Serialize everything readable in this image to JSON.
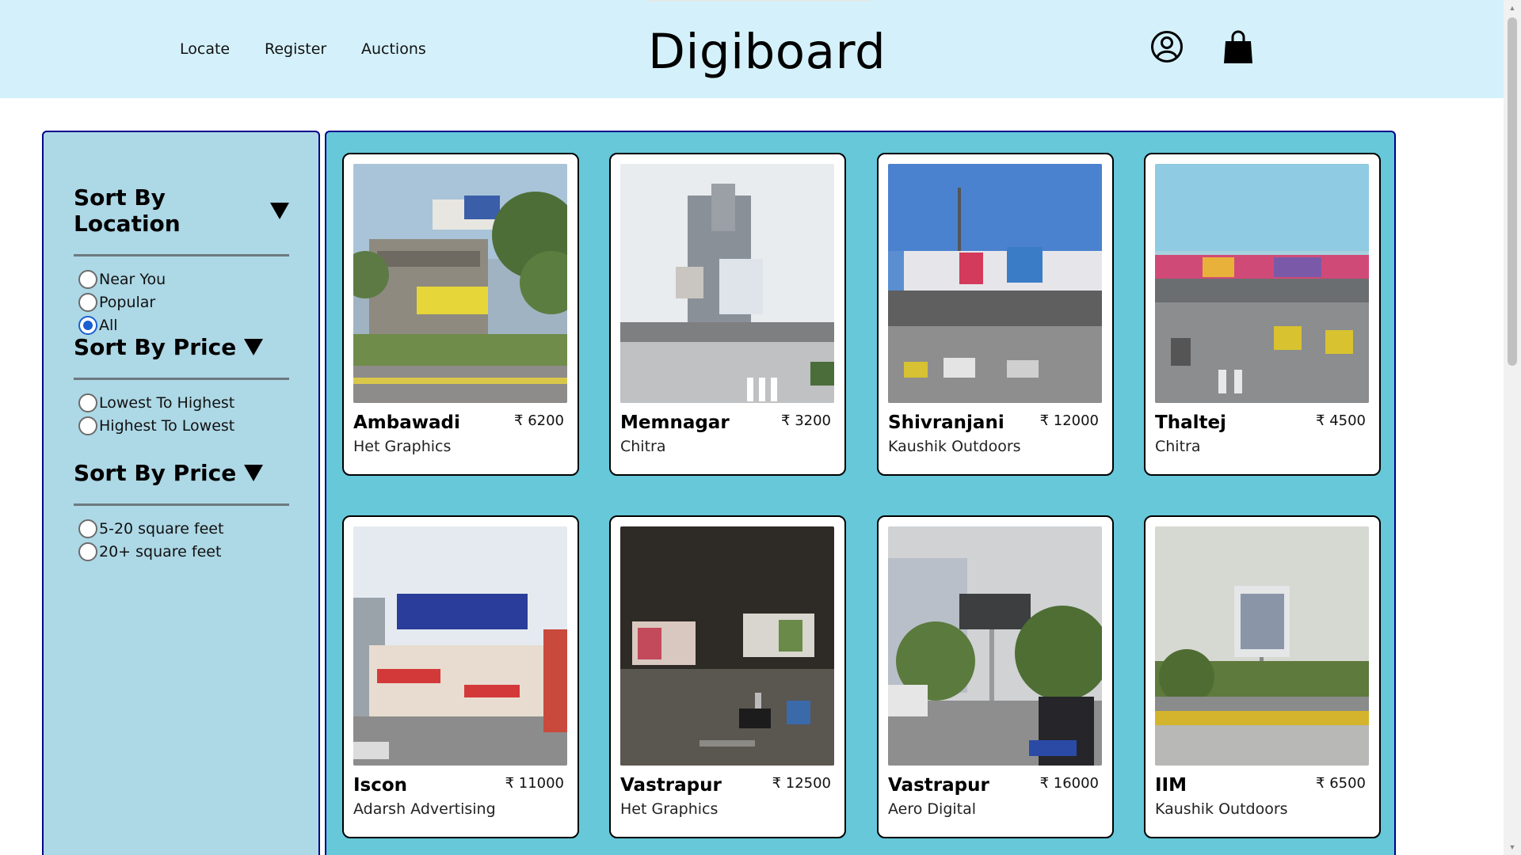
{
  "nav": {
    "links": [
      "Locate",
      "Register",
      "Auctions"
    ],
    "brand": "Digiboard",
    "icons": [
      "user-circle-icon",
      "shopping-bag-icon"
    ]
  },
  "sidebar": {
    "sections": [
      {
        "title": "Sort By Location",
        "options": [
          "Near You",
          "Popular",
          "All"
        ],
        "selected": "All"
      },
      {
        "title": "Sort By Price",
        "options": [
          "Lowest To Highest",
          "Highest To Lowest"
        ],
        "selected": null
      },
      {
        "title": "Sort By Price",
        "options": [
          "5-20 square feet",
          "20+ square feet"
        ],
        "selected": null
      }
    ]
  },
  "listings": [
    {
      "name": "Ambawadi",
      "price": "₹ 6200",
      "agency": "Het Graphics"
    },
    {
      "name": "Memnagar",
      "price": "₹ 3200",
      "agency": "Chitra"
    },
    {
      "name": "Shivranjani",
      "price": "₹ 12000",
      "agency": "Kaushik Outdoors"
    },
    {
      "name": "Thaltej",
      "price": "₹ 4500",
      "agency": "Chitra"
    },
    {
      "name": "Iscon",
      "price": "₹ 11000",
      "agency": "Adarsh Advertising"
    },
    {
      "name": "Vastrapur",
      "price": "₹ 12500",
      "agency": "Het Graphics"
    },
    {
      "name": "Vastrapur",
      "price": "₹ 16000",
      "agency": "Aero Digital"
    },
    {
      "name": "IIM",
      "price": "₹ 6500",
      "agency": "Kaushik Outdoors"
    }
  ],
  "colors": {
    "header_bg": "#d4f1fb",
    "sidebar_bg": "#add8e6",
    "grid_bg": "#66c8d8",
    "border": "#00008b",
    "radio_selected": "#1a5fd1"
  }
}
